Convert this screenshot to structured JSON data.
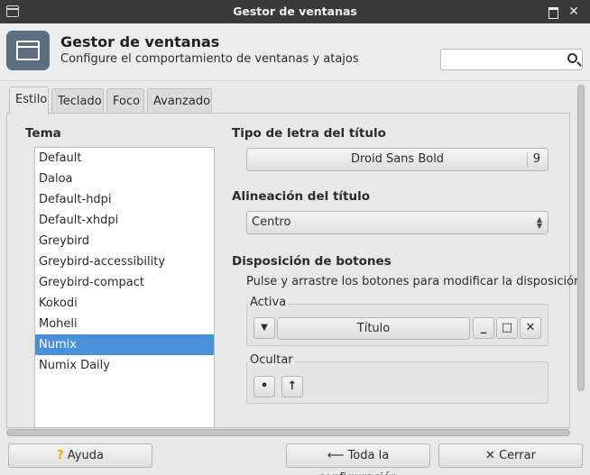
{
  "window": {
    "title": "Gestor de ventanas"
  },
  "header": {
    "title": "Gestor de ventanas",
    "subtitle": "Configure el comportamiento de ventanas y atajos",
    "search_placeholder": ""
  },
  "tabs": [
    {
      "label": "Estilo",
      "active": true
    },
    {
      "label": "Teclado",
      "active": false
    },
    {
      "label": "Foco",
      "active": false
    },
    {
      "label": "Avanzado",
      "active": false
    }
  ],
  "theme": {
    "label": "Tema",
    "items": [
      "Default",
      "Daloa",
      "Default-hdpi",
      "Default-xhdpi",
      "Greybird",
      "Greybird-accessibility",
      "Greybird-compact",
      "Kokodi",
      "Moheli",
      "Numix",
      "Numix Daily"
    ],
    "selected": "Numix"
  },
  "title_font": {
    "label": "Tipo de letra del título",
    "font": "Droid Sans Bold",
    "size": "9"
  },
  "title_align": {
    "label": "Alineación del título",
    "value": "Centro"
  },
  "buttons_layout": {
    "label": "Disposición de botones",
    "hint": "Pulse y arrastre los botones para modificar la disposición",
    "active_label": "Activa",
    "title_button": "Título",
    "hidden_label": "Ocultar"
  },
  "footer": {
    "help": "Ayuda",
    "all_settings": "Toda la configuración",
    "close": "Cerrar"
  },
  "colors": {
    "selection": "#4a90d9",
    "titlebar": "#3a3a3a",
    "app_icon_bg": "#5b6f80",
    "help_icon": "#f0a500"
  }
}
